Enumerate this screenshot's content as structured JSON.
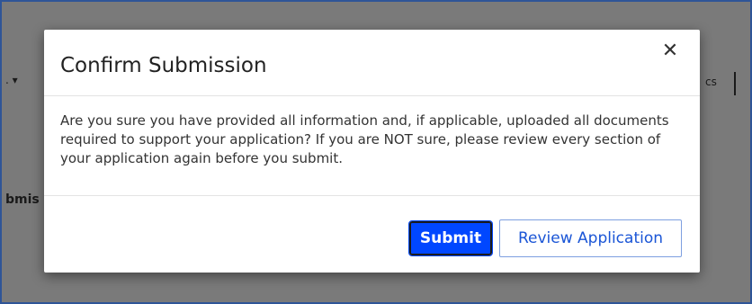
{
  "background": {
    "nav_left_fragment": ". ▾",
    "nav_right_fragment": "cs",
    "heading_fragment": "bmis"
  },
  "dialog": {
    "title": "Confirm Submission",
    "close_glyph": "✕",
    "message": "Are you sure you have provided all information and, if applicable, uploaded all documents required to support your application? If you are NOT sure, please review every section of your application again before you submit.",
    "primary_button": "Submit",
    "secondary_button": "Review Application"
  },
  "colors": {
    "overlay": "#7a7a7a",
    "primary": "#0047ff",
    "link": "#1a55d6",
    "frame_border": "#2f5597"
  }
}
